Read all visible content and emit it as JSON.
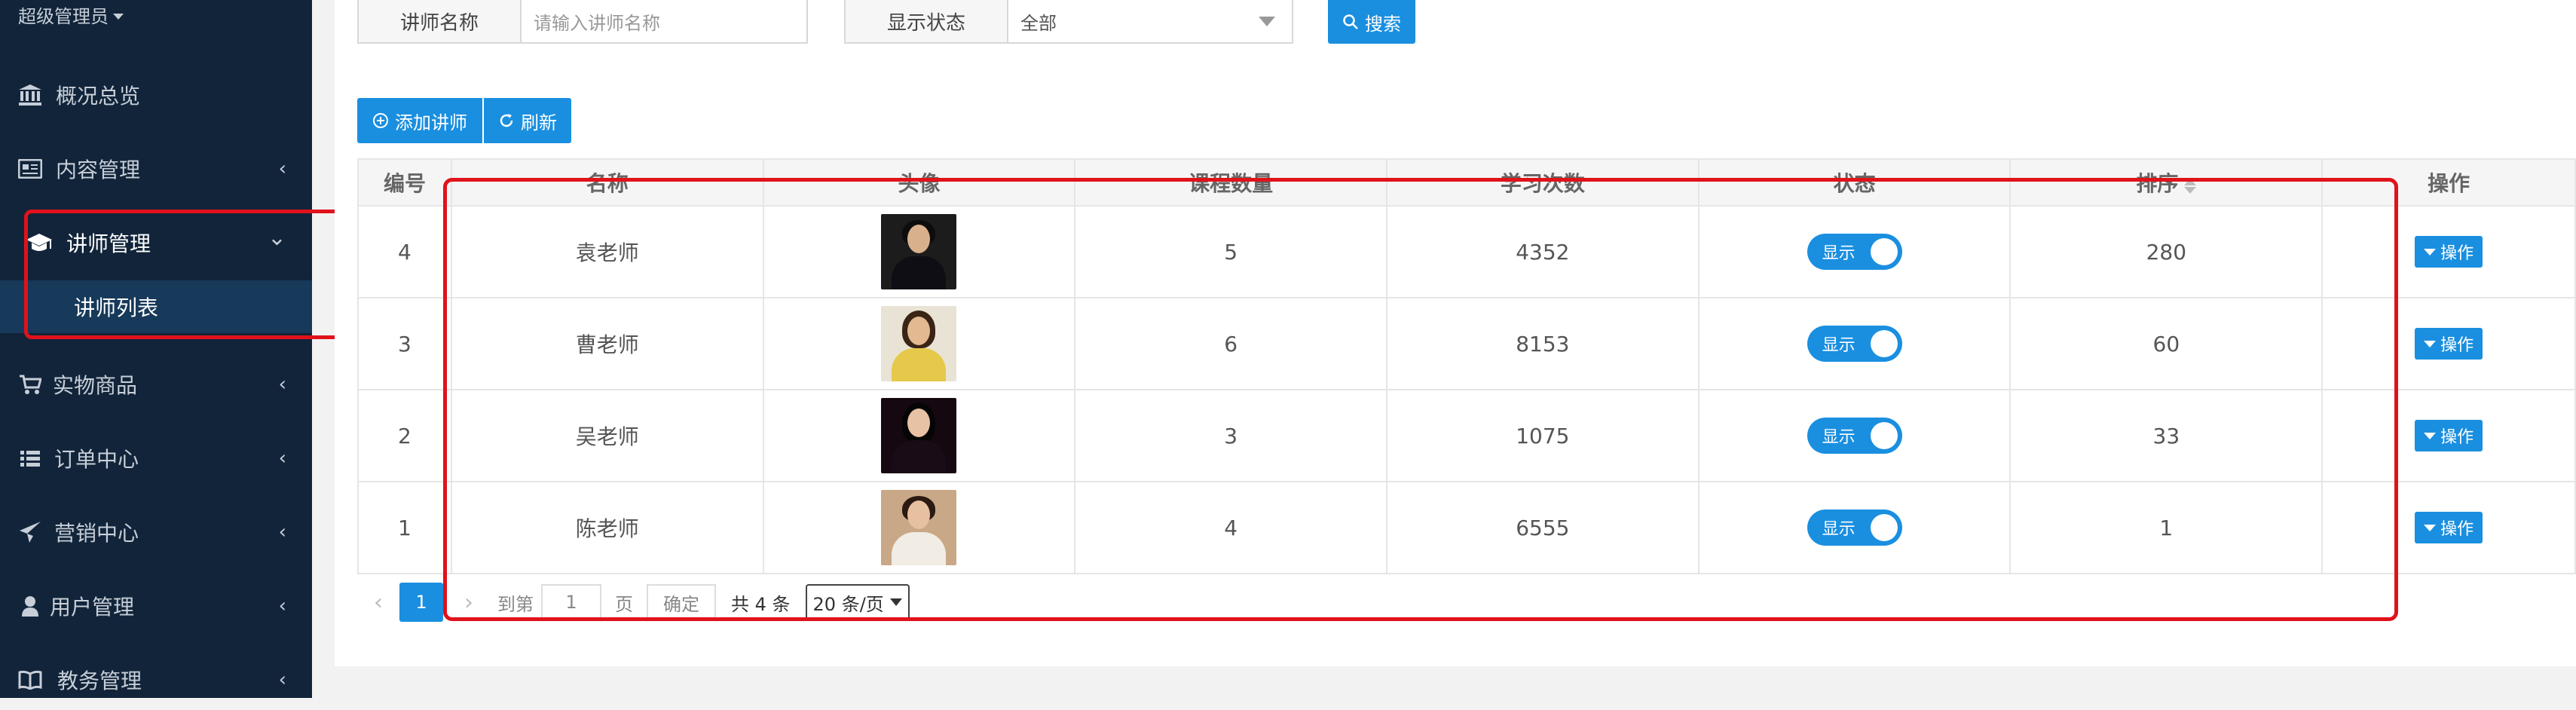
{
  "sidebar": {
    "admin_label": "超级管理员",
    "items": [
      {
        "label": "概况总览",
        "icon": "bank-icon"
      },
      {
        "label": "内容管理",
        "icon": "newspaper-icon"
      },
      {
        "label": "讲师管理",
        "icon": "graduation-cap-icon"
      },
      {
        "label": "实物商品",
        "icon": "cart-icon"
      },
      {
        "label": "订单中心",
        "icon": "list-icon"
      },
      {
        "label": "营销中心",
        "icon": "paper-plane-icon"
      },
      {
        "label": "用户管理",
        "icon": "user-icon"
      },
      {
        "label": "教务管理",
        "icon": "book-icon"
      }
    ],
    "sub_item": "讲师列表",
    "chevron": "‹",
    "chevron_open": "⌄"
  },
  "filters": {
    "name_label": "讲师名称",
    "name_placeholder": "请输入讲师名称",
    "status_label": "显示状态",
    "status_value": "全部",
    "search_button": "搜索"
  },
  "toolbar": {
    "add_button": "添加讲师",
    "refresh_button": "刷新"
  },
  "table": {
    "headers": [
      "编号",
      "名称",
      "头像",
      "课程数量",
      "学习次数",
      "状态",
      "排序",
      "操作"
    ],
    "rows": [
      {
        "id": "4",
        "name": "袁老师",
        "courses": "5",
        "studies": "4352",
        "status": "显示",
        "sort": "280",
        "action": "操作"
      },
      {
        "id": "3",
        "name": "曹老师",
        "courses": "6",
        "studies": "8153",
        "status": "显示",
        "sort": "60",
        "action": "操作"
      },
      {
        "id": "2",
        "name": "吴老师",
        "courses": "3",
        "studies": "1075",
        "status": "显示",
        "sort": "33",
        "action": "操作"
      },
      {
        "id": "1",
        "name": "陈老师",
        "courses": "4",
        "studies": "6555",
        "status": "显示",
        "sort": "1",
        "action": "操作"
      }
    ]
  },
  "pagination": {
    "prev": "‹",
    "current": "1",
    "next": "›",
    "goto_label": "到第",
    "goto_value": "1",
    "page_label": "页",
    "confirm": "确定",
    "total": "共 4 条",
    "page_size": "20 条/页"
  },
  "colors": {
    "sidebar_bg": "#11243a",
    "accent": "#1a8fe0",
    "annotation_red": "#e0121a"
  }
}
